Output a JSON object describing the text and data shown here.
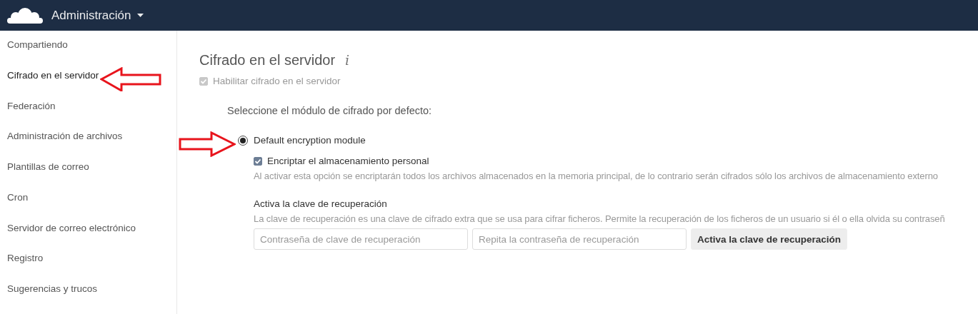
{
  "header": {
    "title": "Administración"
  },
  "sidebar": {
    "items": [
      {
        "label": "Compartiendo",
        "selected": false
      },
      {
        "label": "Cifrado en el servidor",
        "selected": true
      },
      {
        "label": "Federación",
        "selected": false
      },
      {
        "label": "Administración de archivos",
        "selected": false
      },
      {
        "label": "Plantillas de correo",
        "selected": false
      },
      {
        "label": "Cron",
        "selected": false
      },
      {
        "label": "Servidor de correo electrónico",
        "selected": false
      },
      {
        "label": "Registro",
        "selected": false
      },
      {
        "label": "Sugerencias y trucos",
        "selected": false
      }
    ]
  },
  "section": {
    "title": "Cifrado en el servidor",
    "info": "i",
    "enable": {
      "label": "Habilitar cifrado en el servidor",
      "checked": true,
      "disabled": true
    },
    "module_prompt": "Seleccione el módulo de cifrado por defecto:",
    "modules": [
      {
        "label": "Default encryption module",
        "selected": true
      }
    ],
    "home_storage": {
      "label": "Encriptar el almacenamiento personal",
      "checked": true,
      "hint": "Al activar esta opción se encriptarán todos los archivos almacenados en la memoria principal, de lo contrario serán cifrados sólo los archivos de almacenamiento externo"
    },
    "recovery": {
      "title": "Activa la clave de recuperación",
      "hint": "La clave de recuperación es una clave de cifrado extra que se usa para cifrar ficheros. Permite la recuperación de los ficheros de un usuario si él o ella olvida su contraseñ",
      "fields": [
        {
          "placeholder": "Contraseña de clave de recuperación"
        },
        {
          "placeholder": "Repita la contraseña de recuperación"
        }
      ],
      "button": "Activa la clave de recuperación"
    }
  }
}
